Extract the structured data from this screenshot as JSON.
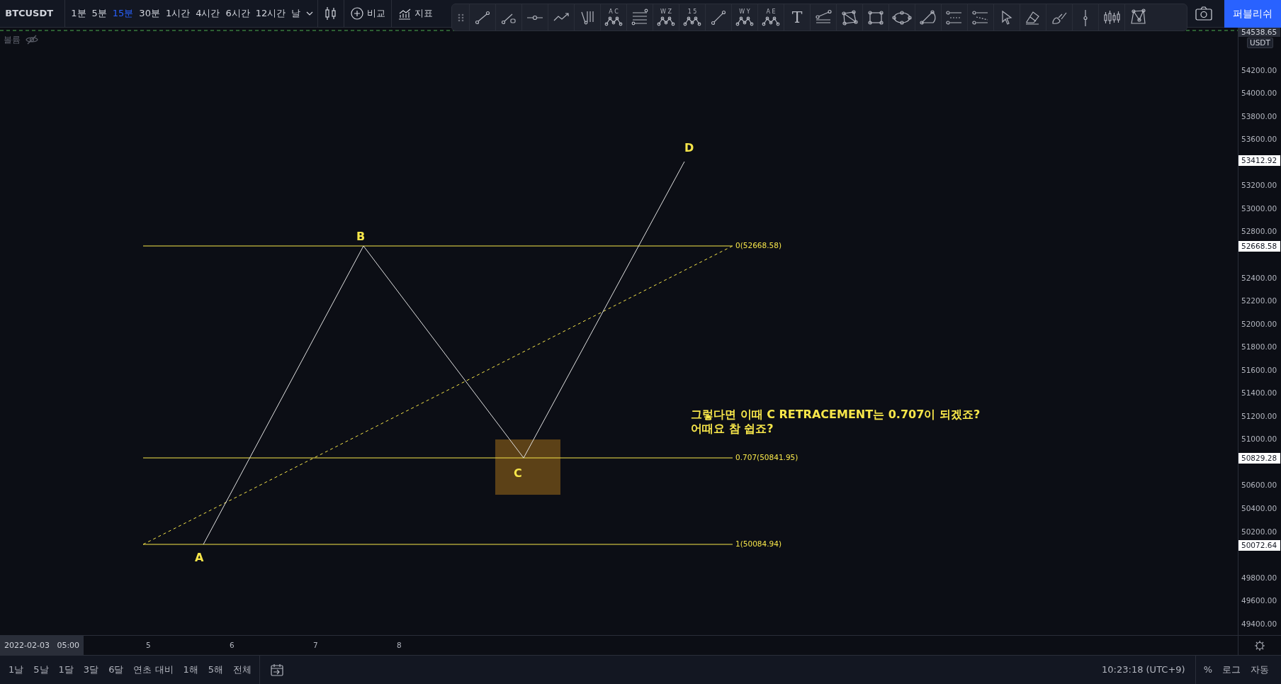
{
  "symbol": "BTCUSDT",
  "intervals": [
    {
      "label": "1분",
      "selected": false
    },
    {
      "label": "5분",
      "selected": false
    },
    {
      "label": "15분",
      "selected": true
    },
    {
      "label": "30분",
      "selected": false
    },
    {
      "label": "1시간",
      "selected": false
    },
    {
      "label": "4시간",
      "selected": false
    },
    {
      "label": "6시간",
      "selected": false
    },
    {
      "label": "12시간",
      "selected": false
    },
    {
      "label": "날",
      "selected": false
    }
  ],
  "compare_label": "비교",
  "indicators_label": "지표",
  "drawing_tools": [
    {
      "kind": "trend"
    },
    {
      "kind": "ray"
    },
    {
      "kind": "hline"
    },
    {
      "kind": "path"
    },
    {
      "kind": "pitchfork"
    },
    {
      "kind": "pattern",
      "label": "A C"
    },
    {
      "kind": "fib"
    },
    {
      "kind": "pattern",
      "label": "W Z"
    },
    {
      "kind": "pattern",
      "label": "1 5"
    },
    {
      "kind": "line"
    },
    {
      "kind": "pattern",
      "label": "W Y"
    },
    {
      "kind": "pattern",
      "label": "A E"
    },
    {
      "kind": "text",
      "label": "T"
    },
    {
      "kind": "fibchannel"
    },
    {
      "kind": "polygon"
    },
    {
      "kind": "rect"
    },
    {
      "kind": "ellipse"
    },
    {
      "kind": "arc"
    },
    {
      "kind": "parallel"
    },
    {
      "kind": "levels"
    },
    {
      "kind": "cursor"
    },
    {
      "kind": "eraser"
    },
    {
      "kind": "brush"
    },
    {
      "kind": "vline"
    },
    {
      "kind": "candles"
    },
    {
      "kind": "xabcd"
    }
  ],
  "publish_label": "퍼블리쉬",
  "volume_label": "볼륨",
  "chart": {
    "points": [
      {
        "label": "D",
        "axis_label": "53412.92"
      },
      {
        "label": "B",
        "axis_label": "52668.58"
      },
      {
        "label": "C",
        "axis_label": "50829.28"
      },
      {
        "label": "A",
        "axis_label": "50072.64"
      }
    ],
    "levels": [
      {
        "label": "0(52668.58)"
      },
      {
        "label": "0.707(50841.95)"
      },
      {
        "label": "1(50084.94)"
      }
    ],
    "note": [
      "그렇다면 이때 C RETRACEMENT는 0.707이 되겠죠?",
      "어때요 참 쉽죠?"
    ],
    "last_price": "54538.65",
    "currency": "USDT",
    "price_ticks": [
      "54200.00",
      "54000.00",
      "53800.00",
      "53600.00",
      "53200.00",
      "53000.00",
      "52800.00",
      "52400.00",
      "52200.00",
      "52000.00",
      "51800.00",
      "51600.00",
      "51400.00",
      "51200.00",
      "51000.00",
      "50600.00",
      "50400.00",
      "50200.00",
      "49800.00",
      "49600.00",
      "49400.00"
    ],
    "time_ticks": [
      "5",
      "6",
      "7",
      "8"
    ],
    "crosshair_time": "2022-02-03   05:00"
  },
  "ranges": [
    "1날",
    "5날",
    "1달",
    "3달",
    "6달",
    "연초 대비",
    "1해",
    "5해",
    "전체"
  ],
  "clock": "10:23:18 (UTC+9)",
  "scale_buttons": [
    "%",
    "로그",
    "자동"
  ]
}
